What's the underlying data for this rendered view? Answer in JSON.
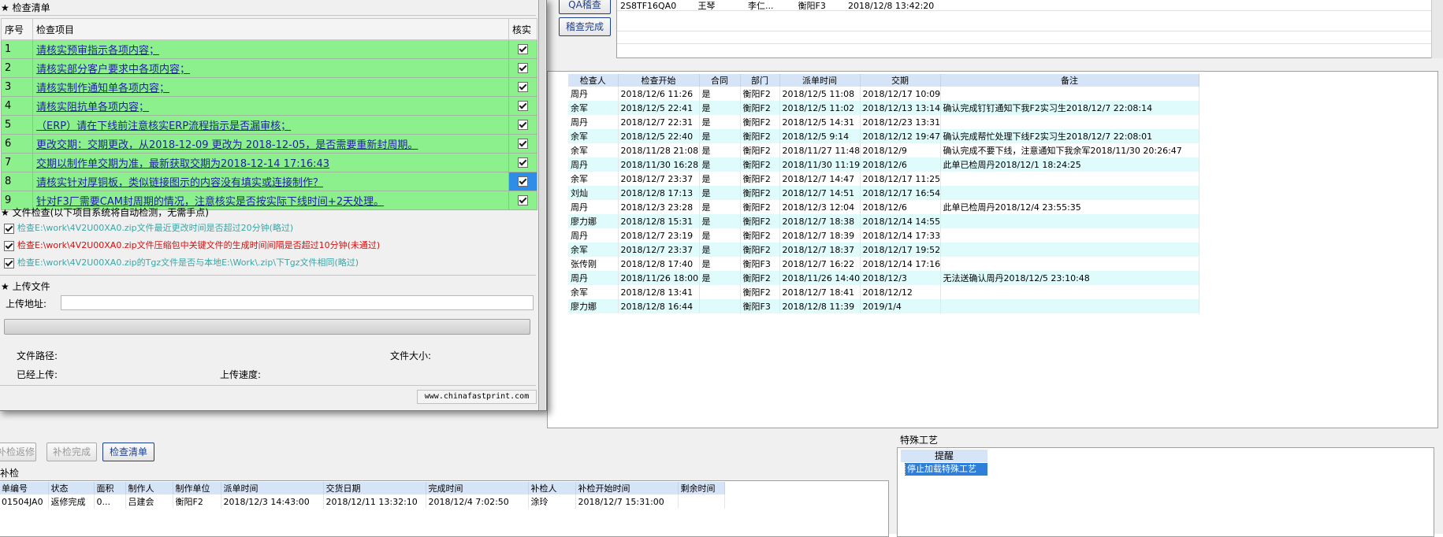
{
  "top": {
    "qa_button": "QA稽查",
    "audit_done_button": "稽查完成",
    "top_row": [
      "2S8TF16QA0",
      "王琴",
      "李仁...",
      "衡阳F3",
      "2018/12/8 13:42:20"
    ]
  },
  "right_grid": {
    "headers": [
      "检查人",
      "检查开始",
      "合同",
      "部门",
      "派单时间",
      "交期",
      "备注"
    ],
    "rows": [
      [
        "周丹",
        "2018/12/6 11:26",
        "是",
        "衡阳F2",
        "2018/12/5 11:08",
        "2018/12/17 10:09",
        ""
      ],
      [
        "余军",
        "2018/12/5 22:41",
        "是",
        "衡阳F2",
        "2018/12/5 11:02",
        "2018/12/13 13:14",
        "确认完成钉钉通知下我F2实习生2018/12/7 22:08:14"
      ],
      [
        "周丹",
        "2018/12/7 22:31",
        "是",
        "衡阳F2",
        "2018/12/5 14:31",
        "2018/12/23 13:31",
        ""
      ],
      [
        "余军",
        "2018/12/5 22:40",
        "是",
        "衡阳F2",
        "2018/12/5 9:14",
        "2018/12/12 19:47",
        "确认完成帮忙处理下线F2实习生2018/12/7 22:08:01"
      ],
      [
        "余军",
        "2018/11/28 21:08",
        "是",
        "衡阳F2",
        "2018/11/27 11:48",
        "2018/12/9",
        "确认完成不要下线，注意通知下我余军2018/11/30 20:26:47"
      ],
      [
        "周丹",
        "2018/11/30 16:28",
        "是",
        "衡阳F2",
        "2018/11/30 11:19",
        "2018/12/6",
        "此单已检周丹2018/12/1 18:24:25"
      ],
      [
        "余军",
        "2018/12/7 23:37",
        "是",
        "衡阳F2",
        "2018/12/7 14:47",
        "2018/12/17 11:25",
        ""
      ],
      [
        "刘灿",
        "2018/12/8 17:13",
        "是",
        "衡阳F2",
        "2018/12/7 14:51",
        "2018/12/17 16:54",
        ""
      ],
      [
        "周丹",
        "2018/12/3 23:28",
        "是",
        "衡阳F2",
        "2018/12/3 12:04",
        "2018/12/6",
        "此单已检周丹2018/12/4 23:55:35"
      ],
      [
        "廖力娜",
        "2018/12/8 15:31",
        "是",
        "衡阳F2",
        "2018/12/7 18:38",
        "2018/12/14 14:55",
        ""
      ],
      [
        "周丹",
        "2018/12/7 23:19",
        "是",
        "衡阳F2",
        "2018/12/7 18:39",
        "2018/12/14 17:33",
        ""
      ],
      [
        "余军",
        "2018/12/7 23:37",
        "是",
        "衡阳F2",
        "2018/12/7 18:37",
        "2018/12/17 19:52",
        ""
      ],
      [
        "张传刚",
        "2018/12/8 17:40",
        "是",
        "衡阳F3",
        "2018/12/7 16:22",
        "2018/12/14 17:16",
        ""
      ],
      [
        "周丹",
        "2018/11/26 18:00",
        "是",
        "衡阳F2",
        "2018/11/26 14:40",
        "2018/12/3",
        "无法送确认周丹2018/12/5 23:10:48"
      ],
      [
        "余军",
        "2018/12/8 13:41",
        "",
        "衡阳F2",
        "2018/12/7 18:41",
        "2018/12/12",
        ""
      ],
      [
        "廖力娜",
        "2018/12/8 16:44",
        "",
        "衡阳F3",
        "2018/12/8 11:39",
        "2019/1/4",
        ""
      ]
    ]
  },
  "dialog": {
    "checklist_title": "检查清单",
    "col_no": "序号",
    "col_item": "检查项目",
    "col_check": "核实",
    "items": [
      {
        "no": "1",
        "text": "请核实预审指示各项内容；"
      },
      {
        "no": "2",
        "text": "请核实部分客户要求中各项内容；"
      },
      {
        "no": "3",
        "text": "请核实制作通知单各项内容；"
      },
      {
        "no": "4",
        "text": "请核实阻抗单各项内容；"
      },
      {
        "no": "5",
        "text": "（ERP）请在下线前注意核实ERP流程指示是否漏审核；"
      },
      {
        "no": "6",
        "text": "更改交期：交期更改，从2018-12-09 更改为 2018-12-05，是否需要重新封周期。"
      },
      {
        "no": "7",
        "text": "交期以制作单交期为准，最新获取交期为2018-12-14 17:16:43"
      },
      {
        "no": "8",
        "text": "请核实针对厚铜板，类似链接图示的内容没有填实或连接制作？"
      },
      {
        "no": "9",
        "text": "针对F3厂需要CAM封周期的情况，注意核实是否按实际下线时间+2天处理。"
      }
    ],
    "file_check_title": "文件检查(以下项目系统将自动检测，无需手点)",
    "file_checks": [
      {
        "text": "检查E:\\work\\4V2U00XA0.zip文件最近更改时间是否超过20分钟(略过)",
        "color": "#3aa6a6"
      },
      {
        "text": "检查E:\\work\\4V2U00XA0.zip文件压缩包中关键文件的生成时间间隔是否超过10分钟(未通过)",
        "color": "#d01010"
      },
      {
        "text": "检查E:\\work\\4V2U00XA0.zip的Tgz文件是否与本地E:\\Work\\.zip\\下Tgz文件相同(略过)",
        "color": "#3aa6a6"
      }
    ],
    "upload_title": "上传文件",
    "upload_addr_label": "上传地址:",
    "upload_addr_value": "",
    "file_path_label": "文件路径:",
    "file_size_label": "文件大小:",
    "uploaded_label": "已经上传:",
    "upload_speed_label": "上传速度:",
    "footer_url": "www.chinafastprint.com",
    "progress": 0
  },
  "bottom": {
    "btn_repair": "补检返修",
    "btn_done": "补检完成",
    "btn_checklist": "检查清单",
    "section_label": "补检",
    "headers": [
      "单编号",
      "状态",
      "面积",
      "制作人",
      "制作单位",
      "派单时间",
      "交货日期",
      "完成时间",
      "补检人",
      "补检开始时间",
      "剩余时间"
    ],
    "rows": [
      [
        "01504JA0",
        "返修完成",
        "0...",
        "吕建会",
        "衡阳F2",
        "2018/12/3 14:43:00",
        "2018/12/11 13:32:10",
        "2018/12/4 7:02:50",
        "涂玲",
        "2018/12/7 15:31:00",
        ""
      ]
    ],
    "special_title": "特殊工艺",
    "special_header": "提醒",
    "special_items": [
      "停止加载特殊工艺"
    ]
  }
}
